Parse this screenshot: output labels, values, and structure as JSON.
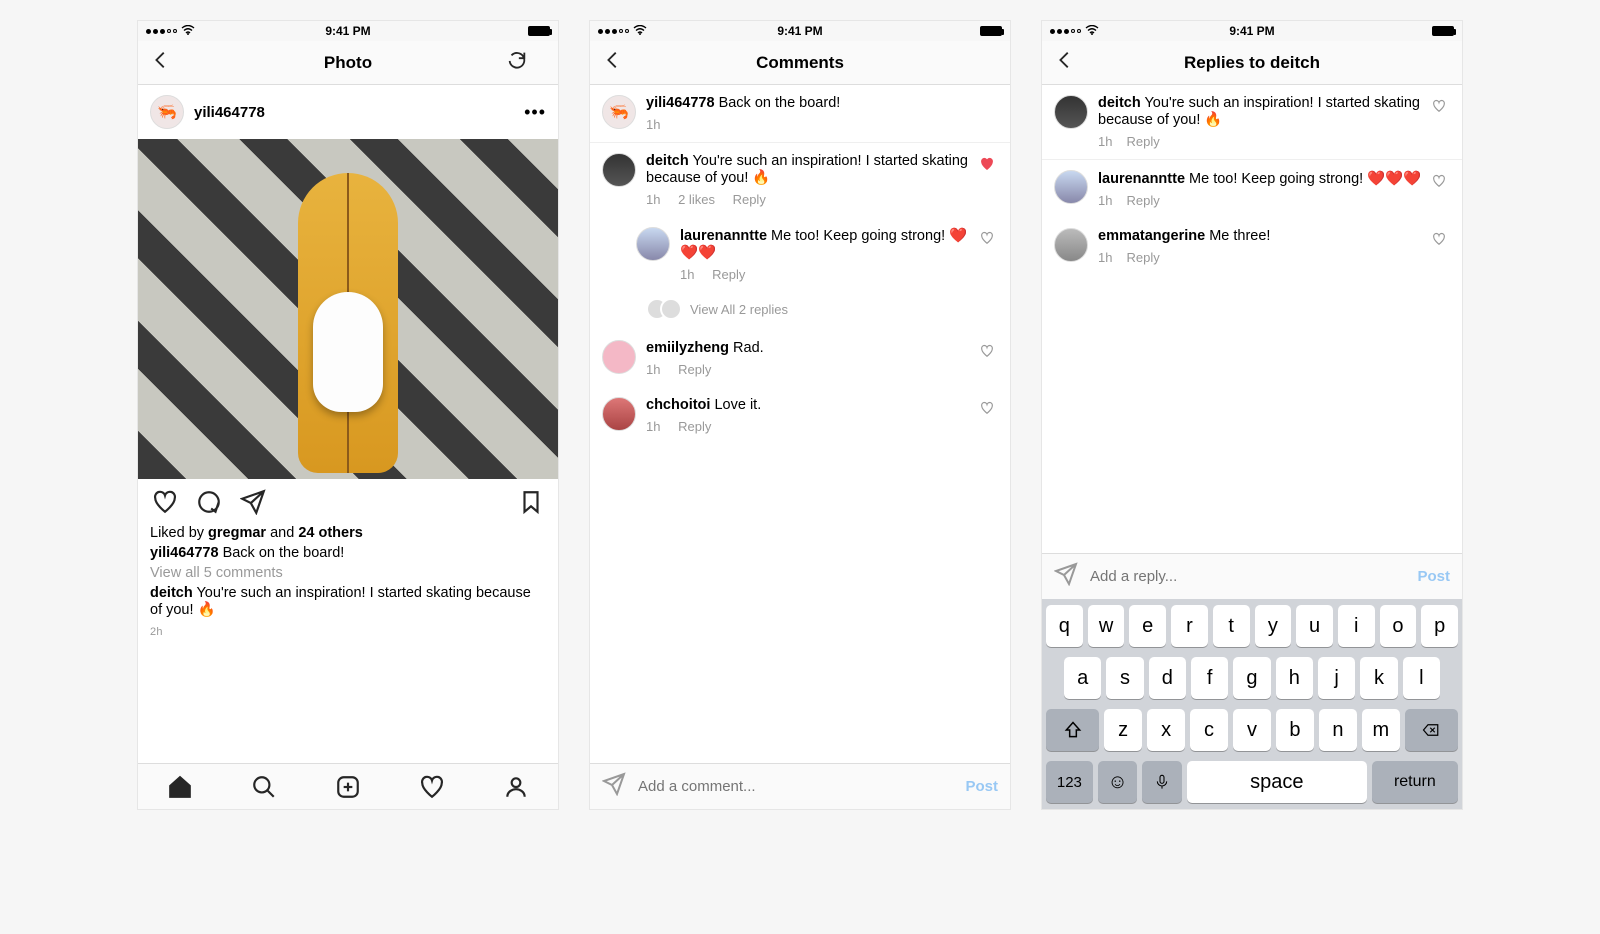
{
  "status": {
    "time": "9:41 PM"
  },
  "screen1": {
    "title": "Photo",
    "post_user": "yili464778",
    "likes_prefix": "Liked by ",
    "likes_user": "gregmar",
    "likes_and": " and ",
    "likes_others": "24 others",
    "caption_user": "yili464778",
    "caption_text": " Back on the board!",
    "view_comments": "View all 5 comments",
    "preview_user": "deitch",
    "preview_text": " You're such an inspiration! I started skating because of you! 🔥",
    "ago": "2h"
  },
  "screen2": {
    "title": "Comments",
    "original": {
      "user": "yili464778",
      "text": " Back on the board!",
      "time": "1h"
    },
    "c1": {
      "user": "deitch",
      "text": " You're such an inspiration! I started skating because of you! 🔥",
      "time": "1h",
      "likes": "2 likes",
      "reply": "Reply"
    },
    "r1": {
      "user": "laurenanntte",
      "text": " Me too! Keep going strong! ❤️❤️❤️",
      "time": "1h",
      "reply": "Reply"
    },
    "view_replies": "View All 2 replies",
    "c2": {
      "user": "emiilyzheng",
      "text": " Rad.",
      "time": "1h",
      "reply": "Reply"
    },
    "c3": {
      "user": "chchoitoi",
      "text": " Love it.",
      "time": "1h",
      "reply": "Reply"
    },
    "placeholder": "Add a comment...",
    "post_btn": "Post"
  },
  "screen3": {
    "title": "Replies to deitch",
    "r1": {
      "user": "deitch",
      "text": " You're such an inspiration! I started skating because of you! 🔥",
      "time": "1h",
      "reply": "Reply"
    },
    "r2": {
      "user": "laurenanntte",
      "text": " Me too! Keep going strong! ❤️❤️❤️",
      "time": "1h",
      "reply": "Reply"
    },
    "r3": {
      "user": "emmatangerine",
      "text": " Me three!",
      "time": "1h",
      "reply": "Reply"
    },
    "placeholder": "Add a reply...",
    "post_btn": "Post",
    "keys_row1": [
      "q",
      "w",
      "e",
      "r",
      "t",
      "y",
      "u",
      "i",
      "o",
      "p"
    ],
    "keys_row2": [
      "a",
      "s",
      "d",
      "f",
      "g",
      "h",
      "j",
      "k",
      "l"
    ],
    "keys_row3": [
      "z",
      "x",
      "c",
      "v",
      "b",
      "n",
      "m"
    ],
    "key_123": "123",
    "key_space": "space",
    "key_return": "return"
  }
}
